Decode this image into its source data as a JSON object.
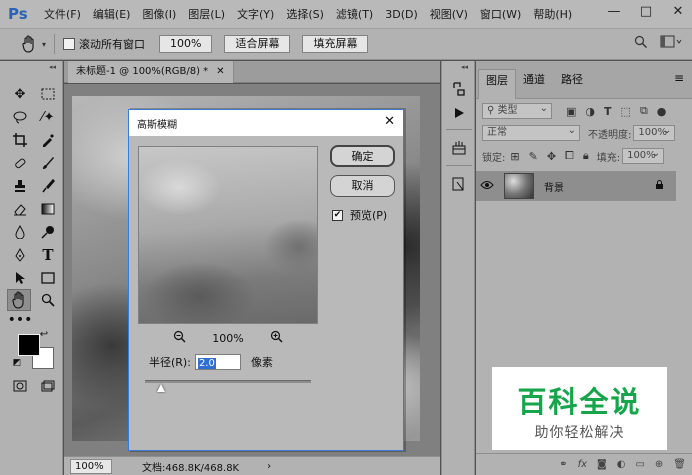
{
  "app": {
    "logo": "Ps"
  },
  "menu": [
    "文件(F)",
    "编辑(E)",
    "图像(I)",
    "图层(L)",
    "文字(Y)",
    "选择(S)",
    "滤镜(T)",
    "3D(D)",
    "视图(V)",
    "窗口(W)",
    "帮助(H)"
  ],
  "options_bar": {
    "scroll_all_label": "滚动所有窗口",
    "btn_100": "100%",
    "btn_fit": "适合屏幕",
    "btn_fill": "填充屏幕"
  },
  "document": {
    "tab_title": "未标题-1 @ 100%(RGB/8) *",
    "status_zoom": "100%",
    "status_doc": "文档:468.8K/468.8K"
  },
  "layers_panel": {
    "tabs": [
      "图层",
      "通道",
      "路径"
    ],
    "filter_label": "类型",
    "blend_mode": "正常",
    "opacity_label": "不透明度:",
    "opacity_value": "100%",
    "lock_label": "锁定:",
    "fill_label": "填充:",
    "fill_value": "100%",
    "layer_name": "背景"
  },
  "dialog": {
    "title": "高斯模糊",
    "ok": "确定",
    "cancel": "取消",
    "preview_label": "预览(P)",
    "preview_checked": true,
    "zoom_value": "100%",
    "radius_label": "半径(R):",
    "radius_value": "2.0",
    "radius_unit": "像素"
  },
  "watermark": {
    "title": "百科全说",
    "subtitle": "助你轻松解决"
  }
}
